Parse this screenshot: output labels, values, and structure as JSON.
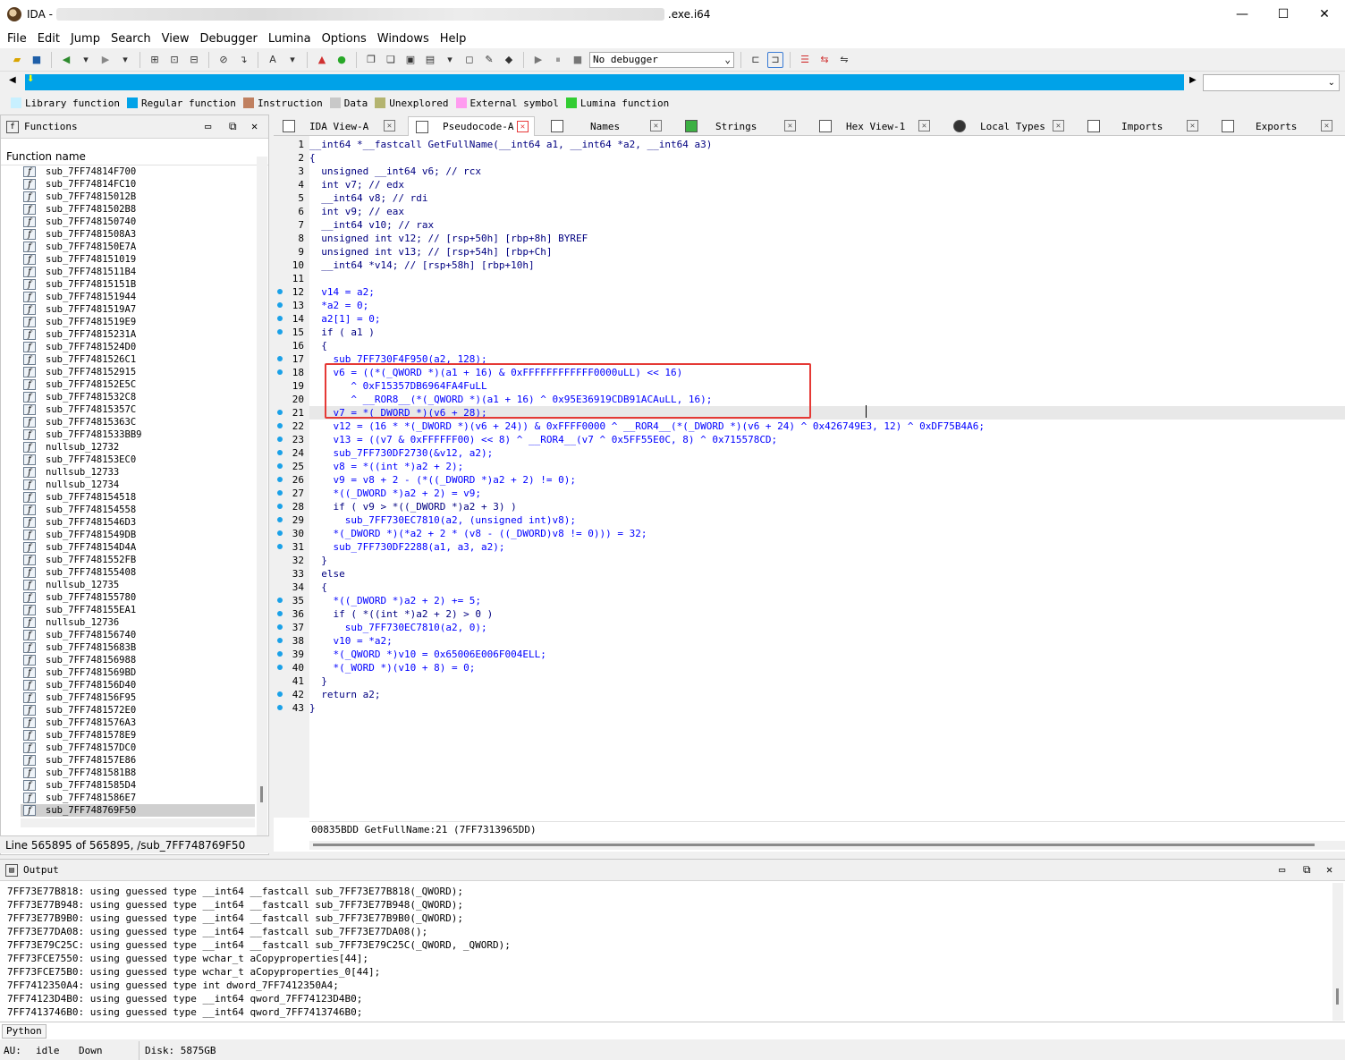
{
  "window": {
    "title_prefix": "IDA - ",
    "title_suffix": ".exe.i64",
    "minimize": "—",
    "maximize": "☐",
    "close": "✕"
  },
  "menu": [
    "File",
    "Edit",
    "Jump",
    "Search",
    "View",
    "Debugger",
    "Lumina",
    "Options",
    "Windows",
    "Help"
  ],
  "toolbar": {
    "debugger_select": "No debugger"
  },
  "legend": [
    {
      "label": "Library function",
      "color": "#c8f0ff"
    },
    {
      "label": "Regular function",
      "color": "#00a2e8"
    },
    {
      "label": "Instruction",
      "color": "#c08060"
    },
    {
      "label": "Data",
      "color": "#c8c8c8"
    },
    {
      "label": "Unexplored",
      "color": "#b4b470"
    },
    {
      "label": "External symbol",
      "color": "#ff9cf0"
    },
    {
      "label": "Lumina function",
      "color": "#32cd32"
    }
  ],
  "functions": {
    "title": "Functions",
    "column": "Function name",
    "items": [
      "sub_7FF74814F700",
      "sub_7FF74814FC10",
      "sub_7FF74815012B",
      "sub_7FF7481502B8",
      "sub_7FF748150740",
      "sub_7FF7481508A3",
      "sub_7FF748150E7A",
      "sub_7FF748151019",
      "sub_7FF7481511B4",
      "sub_7FF74815151B",
      "sub_7FF748151944",
      "sub_7FF7481519A7",
      "sub_7FF7481519E9",
      "sub_7FF74815231A",
      "sub_7FF7481524D0",
      "sub_7FF7481526C1",
      "sub_7FF748152915",
      "sub_7FF748152E5C",
      "sub_7FF7481532C8",
      "sub_7FF74815357C",
      "sub_7FF74815363C",
      "sub_7FF7481533BB9",
      "nullsub_12732",
      "sub_7FF748153EC0",
      "nullsub_12733",
      "nullsub_12734",
      "sub_7FF748154518",
      "sub_7FF748154558",
      "sub_7FF7481546D3",
      "sub_7FF7481549DB",
      "sub_7FF748154D4A",
      "sub_7FF7481552FB",
      "sub_7FF748155408",
      "nullsub_12735",
      "sub_7FF748155780",
      "sub_7FF748155EA1",
      "nullsub_12736",
      "sub_7FF748156740",
      "sub_7FF74815683B",
      "sub_7FF748156988",
      "sub_7FF7481569BD",
      "sub_7FF748156D40",
      "sub_7FF748156F95",
      "sub_7FF7481572E0",
      "sub_7FF7481576A3",
      "sub_7FF7481578E9",
      "sub_7FF748157DC0",
      "sub_7FF748157E86",
      "sub_7FF7481581B8",
      "sub_7FF7481585D4",
      "sub_7FF7481586E7",
      "sub_7FF748769F50"
    ],
    "status": "Line 565895 of 565895, /sub_7FF748769F50"
  },
  "tabs": [
    {
      "label": "IDA View-A"
    },
    {
      "label": "Pseudocode-A"
    },
    {
      "label": "Names"
    },
    {
      "label": "Strings"
    },
    {
      "label": "Hex View-1"
    },
    {
      "label": "Local Types"
    },
    {
      "label": "Imports"
    },
    {
      "label": "Exports"
    }
  ],
  "code": {
    "lines": [
      {
        "n": "1",
        "t": "__int64 *__fastcall GetFullName(__int64 a1, __int64 *a2, __int64 a3)",
        "dot": false
      },
      {
        "n": "2",
        "t": "{",
        "dot": false
      },
      {
        "n": "3",
        "t": "  unsigned __int64 v6; // rcx",
        "dot": false
      },
      {
        "n": "4",
        "t": "  int v7; // edx",
        "dot": false
      },
      {
        "n": "5",
        "t": "  __int64 v8; // rdi",
        "dot": false
      },
      {
        "n": "6",
        "t": "  int v9; // eax",
        "dot": false
      },
      {
        "n": "7",
        "t": "  __int64 v10; // rax",
        "dot": false
      },
      {
        "n": "8",
        "t": "  unsigned int v12; // [rsp+50h] [rbp+8h] BYREF",
        "dot": false
      },
      {
        "n": "9",
        "t": "  unsigned int v13; // [rsp+54h] [rbp+Ch]",
        "dot": false
      },
      {
        "n": "10",
        "t": "  __int64 *v14; // [rsp+58h] [rbp+10h]",
        "dot": false
      },
      {
        "n": "11",
        "t": "",
        "dot": false
      },
      {
        "n": "12",
        "t": "  v14 = a2;",
        "dot": true
      },
      {
        "n": "13",
        "t": "  *a2 = 0;",
        "dot": true
      },
      {
        "n": "14",
        "t": "  a2[1] = 0;",
        "dot": true
      },
      {
        "n": "15",
        "t": "  if ( a1 )",
        "dot": true
      },
      {
        "n": "16",
        "t": "  {",
        "dot": false
      },
      {
        "n": "17",
        "t": "    sub_7FF730F4F950(a2, 128);",
        "dot": true
      },
      {
        "n": "18",
        "t": "    v6 = ((*(_QWORD *)(a1 + 16) & 0xFFFFFFFFFFFF0000uLL) << 16)",
        "dot": true
      },
      {
        "n": "19",
        "t": "       ^ 0xF15357DB6964FA4FuLL",
        "dot": false
      },
      {
        "n": "20",
        "t": "       ^ __ROR8__(*(_QWORD *)(a1 + 16) ^ 0x95E36919CDB91ACAuLL, 16);",
        "dot": false
      },
      {
        "n": "21",
        "t": "    v7 = *(_DWORD *)(v6 + 28);",
        "dot": true
      },
      {
        "n": "22",
        "t": "    v12 = (16 * *(_DWORD *)(v6 + 24)) & 0xFFFF0000 ^ __ROR4__(*(_DWORD *)(v6 + 24) ^ 0x426749E3, 12) ^ 0xDF75B4A6;",
        "dot": true
      },
      {
        "n": "23",
        "t": "    v13 = ((v7 & 0xFFFFFF00) << 8) ^ __ROR4__(v7 ^ 0x5FF55E0C, 8) ^ 0x715578CD;",
        "dot": true
      },
      {
        "n": "24",
        "t": "    sub_7FF730DF2730(&v12, a2);",
        "dot": true
      },
      {
        "n": "25",
        "t": "    v8 = *((int *)a2 + 2);",
        "dot": true
      },
      {
        "n": "26",
        "t": "    v9 = v8 + 2 - (*((_DWORD *)a2 + 2) != 0);",
        "dot": true
      },
      {
        "n": "27",
        "t": "    *((_DWORD *)a2 + 2) = v9;",
        "dot": true
      },
      {
        "n": "28",
        "t": "    if ( v9 > *((_DWORD *)a2 + 3) )",
        "dot": true
      },
      {
        "n": "29",
        "t": "      sub_7FF730EC7810(a2, (unsigned int)v8);",
        "dot": true
      },
      {
        "n": "30",
        "t": "    *(_DWORD *)(*a2 + 2 * (v8 - ((_DWORD)v8 != 0))) = 32;",
        "dot": true
      },
      {
        "n": "31",
        "t": "    sub_7FF730DF2288(a1, a3, a2);",
        "dot": true
      },
      {
        "n": "32",
        "t": "  }",
        "dot": false
      },
      {
        "n": "33",
        "t": "  else",
        "dot": false
      },
      {
        "n": "34",
        "t": "  {",
        "dot": false
      },
      {
        "n": "35",
        "t": "    *((_DWORD *)a2 + 2) += 5;",
        "dot": true
      },
      {
        "n": "36",
        "t": "    if ( *((int *)a2 + 2) > 0 )",
        "dot": true
      },
      {
        "n": "37",
        "t": "      sub_7FF730EC7810(a2, 0);",
        "dot": true
      },
      {
        "n": "38",
        "t": "    v10 = *a2;",
        "dot": true
      },
      {
        "n": "39",
        "t": "    *(_QWORD *)v10 = 0x65006E006F004ELL;",
        "dot": true
      },
      {
        "n": "40",
        "t": "    *(_WORD *)(v10 + 8) = 0;",
        "dot": true
      },
      {
        "n": "41",
        "t": "  }",
        "dot": false
      },
      {
        "n": "42",
        "t": "  return a2;",
        "dot": true
      },
      {
        "n": "43",
        "t": "}",
        "dot": true
      }
    ],
    "status": "00835BDD GetFullName:21 (7FF7313965DD)"
  },
  "output": {
    "title": "Output",
    "lines": [
      "7FF73E77B818: using guessed type __int64 __fastcall sub_7FF73E77B818(_QWORD);",
      "7FF73E77B948: using guessed type __int64 __fastcall sub_7FF73E77B948(_QWORD);",
      "7FF73E77B9B0: using guessed type __int64 __fastcall sub_7FF73E77B9B0(_QWORD);",
      "7FF73E77DA08: using guessed type __int64 __fastcall sub_7FF73E77DA08();",
      "7FF73E79C25C: using guessed type __int64 __fastcall sub_7FF73E79C25C(_QWORD, _QWORD);",
      "7FF73FCE7550: using guessed type wchar_t aCopyproperties[44];",
      "7FF73FCE75B0: using guessed type wchar_t aCopyproperties_0[44];",
      "7FF7412350A4: using guessed type int dword_7FF7412350A4;",
      "7FF74123D4B0: using guessed type __int64 qword_7FF74123D4B0;",
      "7FF7413746B0: using guessed type __int64 qword_7FF7413746B0;"
    ]
  },
  "python_button": "Python",
  "status": {
    "au": "AU:",
    "state": "idle",
    "dir": "Down",
    "disk": "Disk: 5875GB"
  }
}
